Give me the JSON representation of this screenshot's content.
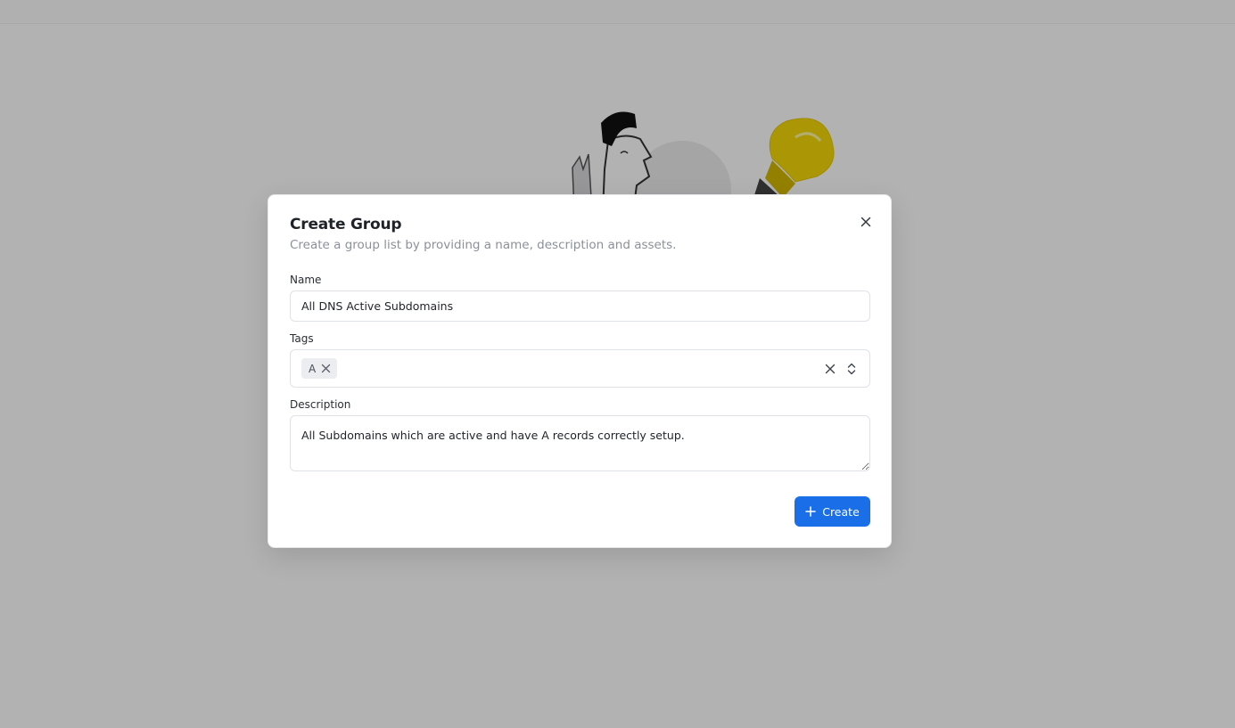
{
  "dialog": {
    "title": "Create Group",
    "description": "Create a group list by providing a name, description and assets.",
    "close_icon": "close-icon"
  },
  "form": {
    "name": {
      "label": "Name",
      "value": "All DNS Active Subdomains"
    },
    "tags": {
      "label": "Tags",
      "selected": [
        "A"
      ],
      "remove_icon": "x-icon",
      "clear_icon": "close-icon",
      "toggle_icon": "chevron-up-down-icon"
    },
    "description": {
      "label": "Description",
      "value": "All Subdomains which are active and have A records correctly setup."
    }
  },
  "actions": {
    "create_label": "Create",
    "create_icon": "plus-icon"
  },
  "colors": {
    "primary": "#1a6ee8",
    "overlay": "rgba(0,0,0,0.30)",
    "bulb": "#f5d90a"
  }
}
